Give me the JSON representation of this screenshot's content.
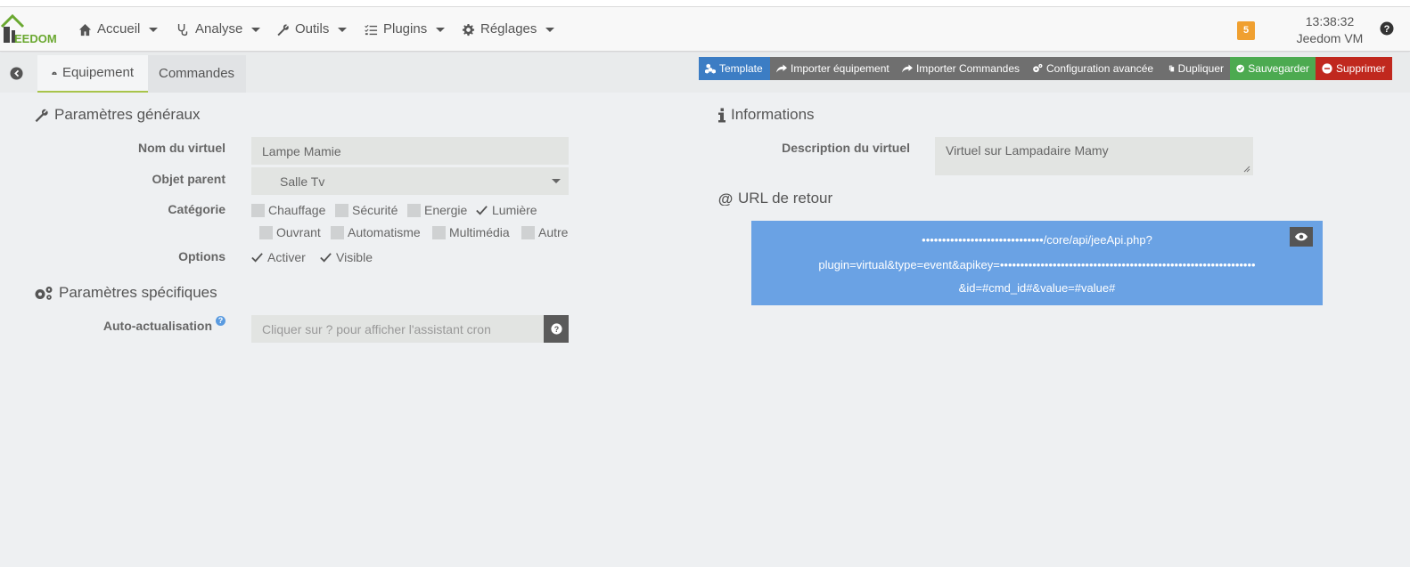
{
  "navbar": {
    "logo_text": "EEDOM",
    "items": [
      {
        "label": "Accueil",
        "icon": "home-icon"
      },
      {
        "label": "Analyse",
        "icon": "stethoscope-icon"
      },
      {
        "label": "Outils",
        "icon": "wrench-icon"
      },
      {
        "label": "Plugins",
        "icon": "tasks-icon"
      },
      {
        "label": "Réglages",
        "icon": "cog-icon"
      }
    ],
    "message_count": "5",
    "time": "13:38:32",
    "host": "Jeedom VM"
  },
  "tabs": {
    "equipment": "Equipement",
    "commands": "Commandes"
  },
  "actions": {
    "template": "Template",
    "import_equipment": "Importer équipement",
    "import_commands": "Importer Commandes",
    "advanced_config": "Configuration avancée",
    "duplicate": "Dupliquer",
    "save": "Sauvegarder",
    "delete": "Supprimer"
  },
  "general": {
    "title": "Paramètres généraux",
    "name_label": "Nom du virtuel",
    "name_value": "Lampe Mamie",
    "parent_label": "Objet parent",
    "parent_value": "Salle Tv",
    "category_label": "Catégorie",
    "categories": [
      {
        "label": "Chauffage",
        "checked": false
      },
      {
        "label": "Sécurité",
        "checked": false
      },
      {
        "label": "Energie",
        "checked": false
      },
      {
        "label": "Lumière",
        "checked": true
      },
      {
        "label": "Ouvrant",
        "checked": false
      },
      {
        "label": "Automatisme",
        "checked": false
      },
      {
        "label": "Multimédia",
        "checked": false
      },
      {
        "label": "Autre",
        "checked": false
      }
    ],
    "options_label": "Options",
    "options": [
      {
        "label": "Activer",
        "checked": true
      },
      {
        "label": "Visible",
        "checked": true
      }
    ]
  },
  "specific": {
    "title": "Paramètres spécifiques",
    "auto_label": "Auto-actualisation",
    "auto_placeholder": "Cliquer sur ? pour afficher l'assistant cron",
    "help_glyph": "?"
  },
  "info": {
    "title": "Informations",
    "desc_label": "Description du virtuel",
    "desc_value": "Virtuel sur Lampadaire Mamy"
  },
  "url": {
    "title": "URL de retour",
    "line1": "••••••••••••••••••••••••••••••/core/api/jeeApi.php?",
    "line2": "plugin=virtual&type=event&apikey=•••••••••••••••••••••••••••••••••••••••••••••••••••••••••••••••",
    "line3": "&id=#cmd_id#&value=#value#"
  },
  "colors": {
    "accent_green": "#a8c44a",
    "template_blue": "#3c7dc4",
    "save_green": "#4caa50",
    "delete_red": "#c0281e",
    "url_blue": "#6aa2e4",
    "badge_orange": "#f0a030"
  }
}
